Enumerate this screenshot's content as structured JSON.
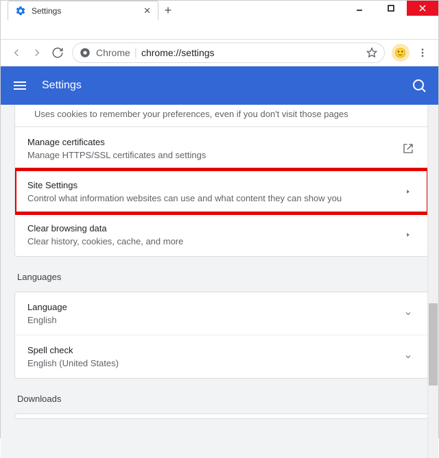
{
  "window": {
    "tab_title": "Settings"
  },
  "omnibox": {
    "scheme": "Chrome",
    "url": "chrome://settings"
  },
  "appbar": {
    "title": "Settings"
  },
  "privacy": {
    "cutoff_text": "Uses cookies to remember your preferences, even if you don't visit those pages",
    "rows": [
      {
        "title": "Manage certificates",
        "sub": "Manage HTTPS/SSL certificates and settings"
      },
      {
        "title": "Site Settings",
        "sub": "Control what information websites can use and what content they can show you"
      },
      {
        "title": "Clear browsing data",
        "sub": "Clear history, cookies, cache, and more"
      }
    ]
  },
  "sections": {
    "languages": "Languages",
    "downloads": "Downloads"
  },
  "languages": {
    "rows": [
      {
        "title": "Language",
        "sub": "English"
      },
      {
        "title": "Spell check",
        "sub": "English (United States)"
      }
    ]
  }
}
